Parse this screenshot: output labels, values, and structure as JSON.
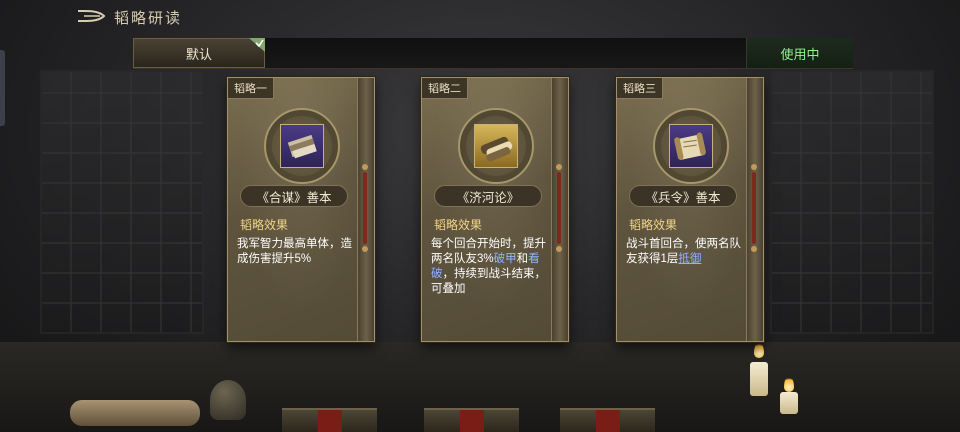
{
  "header": {
    "title": "韬略研读"
  },
  "tabs": [
    {
      "label": "默认",
      "selected": true
    }
  ],
  "status": {
    "label": "使用中"
  },
  "cards": [
    {
      "tag": "韬略一",
      "icon": "book-bundle-icon",
      "name": "《合谋》善本",
      "effect_title": "韬略效果",
      "desc": {
        "text": "我军智力最高单体，造成伤害提升5%"
      }
    },
    {
      "tag": "韬略二",
      "icon": "scroll-bundle-icon",
      "name": "《济河论》",
      "effect_title": "韬略效果",
      "desc": {
        "p1": "每个回合开始时，提升两名队友3%",
        "k1": "破甲",
        "p2": "和",
        "k2": "看破",
        "p3": "，持续到战斗结束，可叠加"
      }
    },
    {
      "tag": "韬略三",
      "icon": "scroll-icon",
      "name": "《兵令》善本",
      "effect_title": "韬略效果",
      "desc": {
        "p1": "战斗首回合，使两名队友获得1层",
        "k1": "抵御"
      }
    }
  ],
  "colors": {
    "status_green": "#8ff58a",
    "effect_title": "#f2d488",
    "keyword_blue": "#8db4ff"
  }
}
